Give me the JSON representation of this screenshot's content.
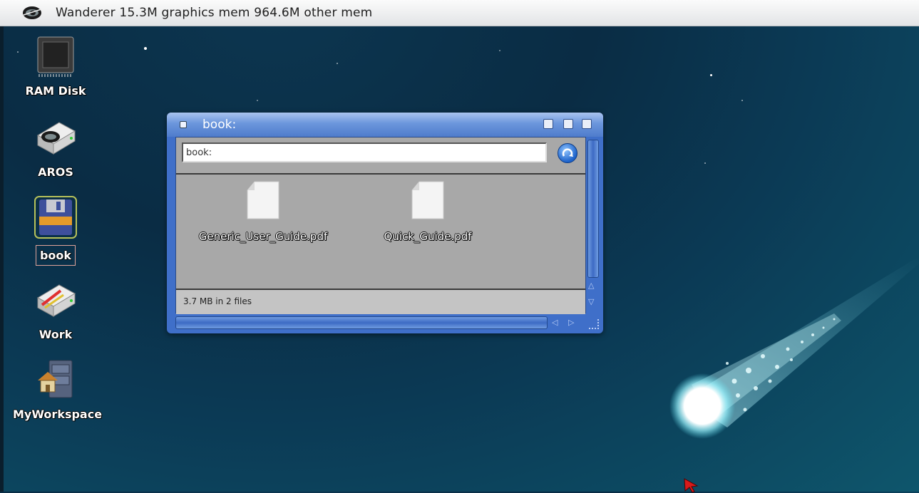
{
  "screenbar": {
    "title": "Wanderer 15.3M graphics mem 964.6M other mem",
    "logo_icon": "aros-cat-eye-icon"
  },
  "desktop": {
    "icons": [
      {
        "label": "RAM Disk",
        "icon": "chip-icon",
        "selected": false
      },
      {
        "label": "AROS",
        "icon": "drive-icon",
        "selected": false
      },
      {
        "label": "book",
        "icon": "floppy-disk-icon",
        "selected": true
      },
      {
        "label": "Work",
        "icon": "drive-icon",
        "selected": false
      },
      {
        "label": "MyWorkspace",
        "icon": "home-cabinet-icon",
        "selected": false
      }
    ]
  },
  "window": {
    "title": "book:",
    "path_value": "book:",
    "files": [
      {
        "name": "Generic_User_Guide.pdf",
        "icon": "document-icon"
      },
      {
        "name": "Quick_Guide.pdf",
        "icon": "document-icon"
      }
    ],
    "status": "3.7 MB in 2 files",
    "scroll_up": "△",
    "scroll_down": "▽",
    "scroll_left": "◁",
    "scroll_right": "▷"
  },
  "colors": {
    "window_frame": "#3f6fc9",
    "window_body": "#a8a8a8",
    "desktop_bg": "#0b3a55"
  }
}
